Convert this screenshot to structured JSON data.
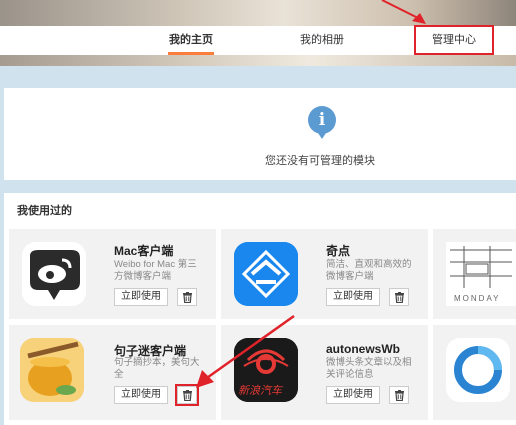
{
  "nav": {
    "tabs": [
      {
        "label": "我的主页",
        "active": true
      },
      {
        "label": "我的相册",
        "active": false
      },
      {
        "label": "管理中心",
        "active": false
      }
    ]
  },
  "management": {
    "icon": "info-icon",
    "empty_message": "您还没有可管理的模块"
  },
  "used_apps": {
    "title": "我使用过的",
    "apps": [
      {
        "name": "Mac客户端",
        "desc": "Weibo for Mac 第三方微博客户端",
        "use_label": "立即使用",
        "icon": "weibo-chat-bubble-icon"
      },
      {
        "name": "奇点",
        "desc": "简洁、直观和高效的微博客户端",
        "use_label": "立即使用",
        "icon": "qidian-icon"
      },
      {
        "name": "句子迷客户端",
        "desc": "句子摘抄本，美句大全",
        "use_label": "立即使用",
        "icon": "honey-jar-icon"
      },
      {
        "name": "autonewsWb",
        "desc": "微博头条文章以及相关评论信息",
        "use_label": "立即使用",
        "icon": "sina-auto-icon",
        "icon_text": "新浪汽车"
      }
    ],
    "partial_apps": [
      {
        "icon": "monday-icon",
        "icon_text": "MONDAY"
      },
      {
        "icon": "ring-icon"
      }
    ]
  },
  "colors": {
    "highlight": "#e0222a",
    "tab_accent": "#fa7d3c",
    "info_blue": "#5b9bd1"
  }
}
